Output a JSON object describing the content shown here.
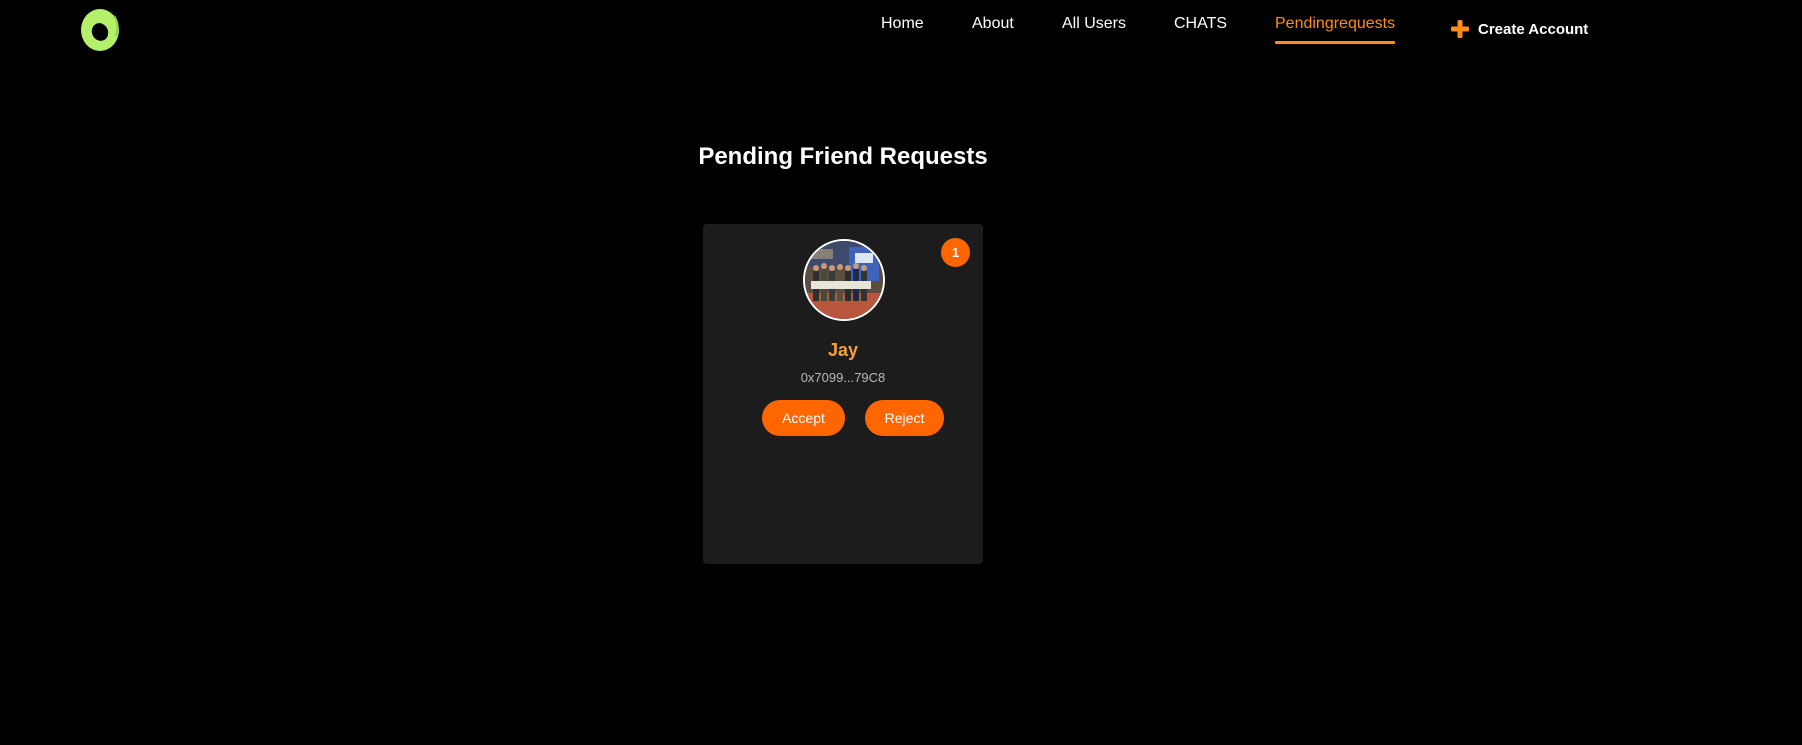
{
  "nav": {
    "logo_icon": "green-ring-logo-icon",
    "links": [
      {
        "label": "Home",
        "active": false
      },
      {
        "label": "About",
        "active": false
      },
      {
        "label": "All Users",
        "active": false
      },
      {
        "label": "CHATS",
        "active": false
      },
      {
        "label": "Pendingrequests",
        "active": true
      }
    ],
    "create_account": {
      "label": "Create Account",
      "icon": "plus-icon"
    }
  },
  "main": {
    "title": "Pending Friend Requests",
    "requests": [
      {
        "count_badge": "1",
        "avatar_icon": "user-photo-avatar",
        "name": "Jay",
        "address": "0x7099...79C8",
        "accept_label": "Accept",
        "reject_label": "Reject"
      }
    ]
  },
  "colors": {
    "background": "#000000",
    "accent": "#ff6600",
    "active_nav": "#ff8c1a",
    "name": "#f5a13a",
    "card": "#1c1c1c",
    "logo": "#b4f06a"
  }
}
